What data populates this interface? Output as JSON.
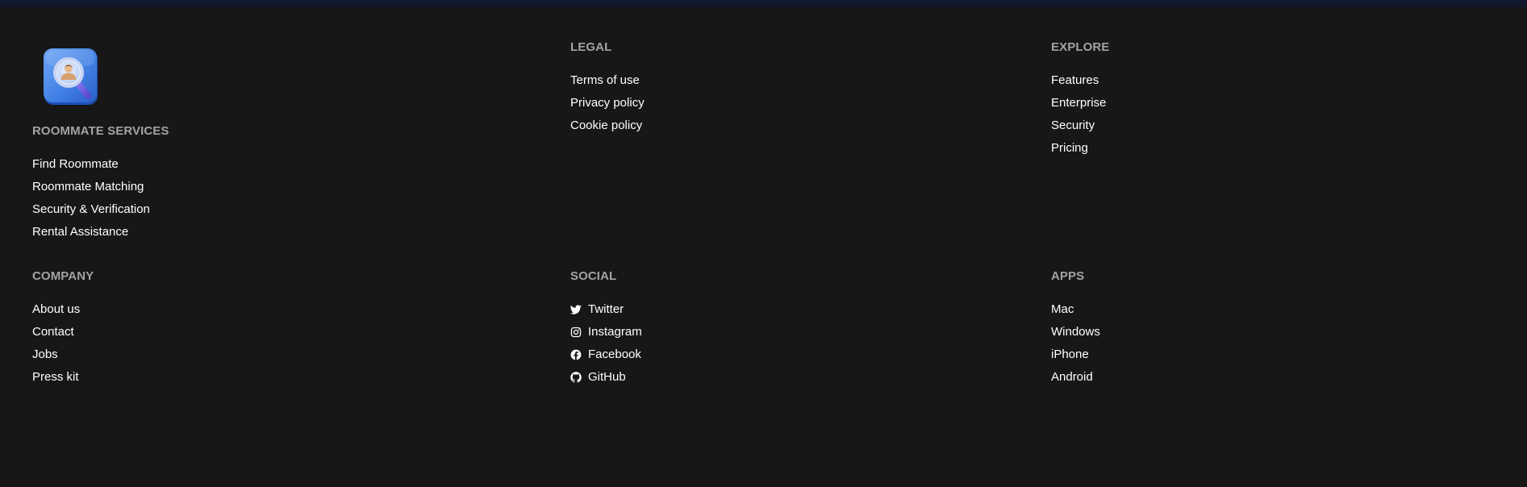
{
  "footer": {
    "roommate_services": {
      "heading": "ROOMMATE SERVICES",
      "links": [
        "Find Roommate",
        "Roommate Matching",
        "Security & Verification",
        "Rental Assistance"
      ]
    },
    "legal": {
      "heading": "LEGAL",
      "links": [
        "Terms of use",
        "Privacy policy",
        "Cookie policy"
      ]
    },
    "explore": {
      "heading": "EXPLORE",
      "links": [
        "Features",
        "Enterprise",
        "Security",
        "Pricing"
      ]
    },
    "company": {
      "heading": "COMPANY",
      "links": [
        "About us",
        "Contact",
        "Jobs",
        "Press kit"
      ]
    },
    "social": {
      "heading": "SOCIAL",
      "links": [
        {
          "label": "Twitter",
          "icon": "twitter-icon"
        },
        {
          "label": "Instagram",
          "icon": "instagram-icon"
        },
        {
          "label": "Facebook",
          "icon": "facebook-icon"
        },
        {
          "label": "GitHub",
          "icon": "github-icon"
        }
      ]
    },
    "apps": {
      "heading": "APPS",
      "links": [
        "Mac",
        "Windows",
        "iPhone",
        "Android"
      ]
    }
  },
  "logo": {
    "icon": "magnifier-person-icon"
  },
  "colors": {
    "background": "#171717",
    "heading": "#a3a3a3",
    "link": "#ffffff",
    "logo_blue": "#4a82e6"
  }
}
